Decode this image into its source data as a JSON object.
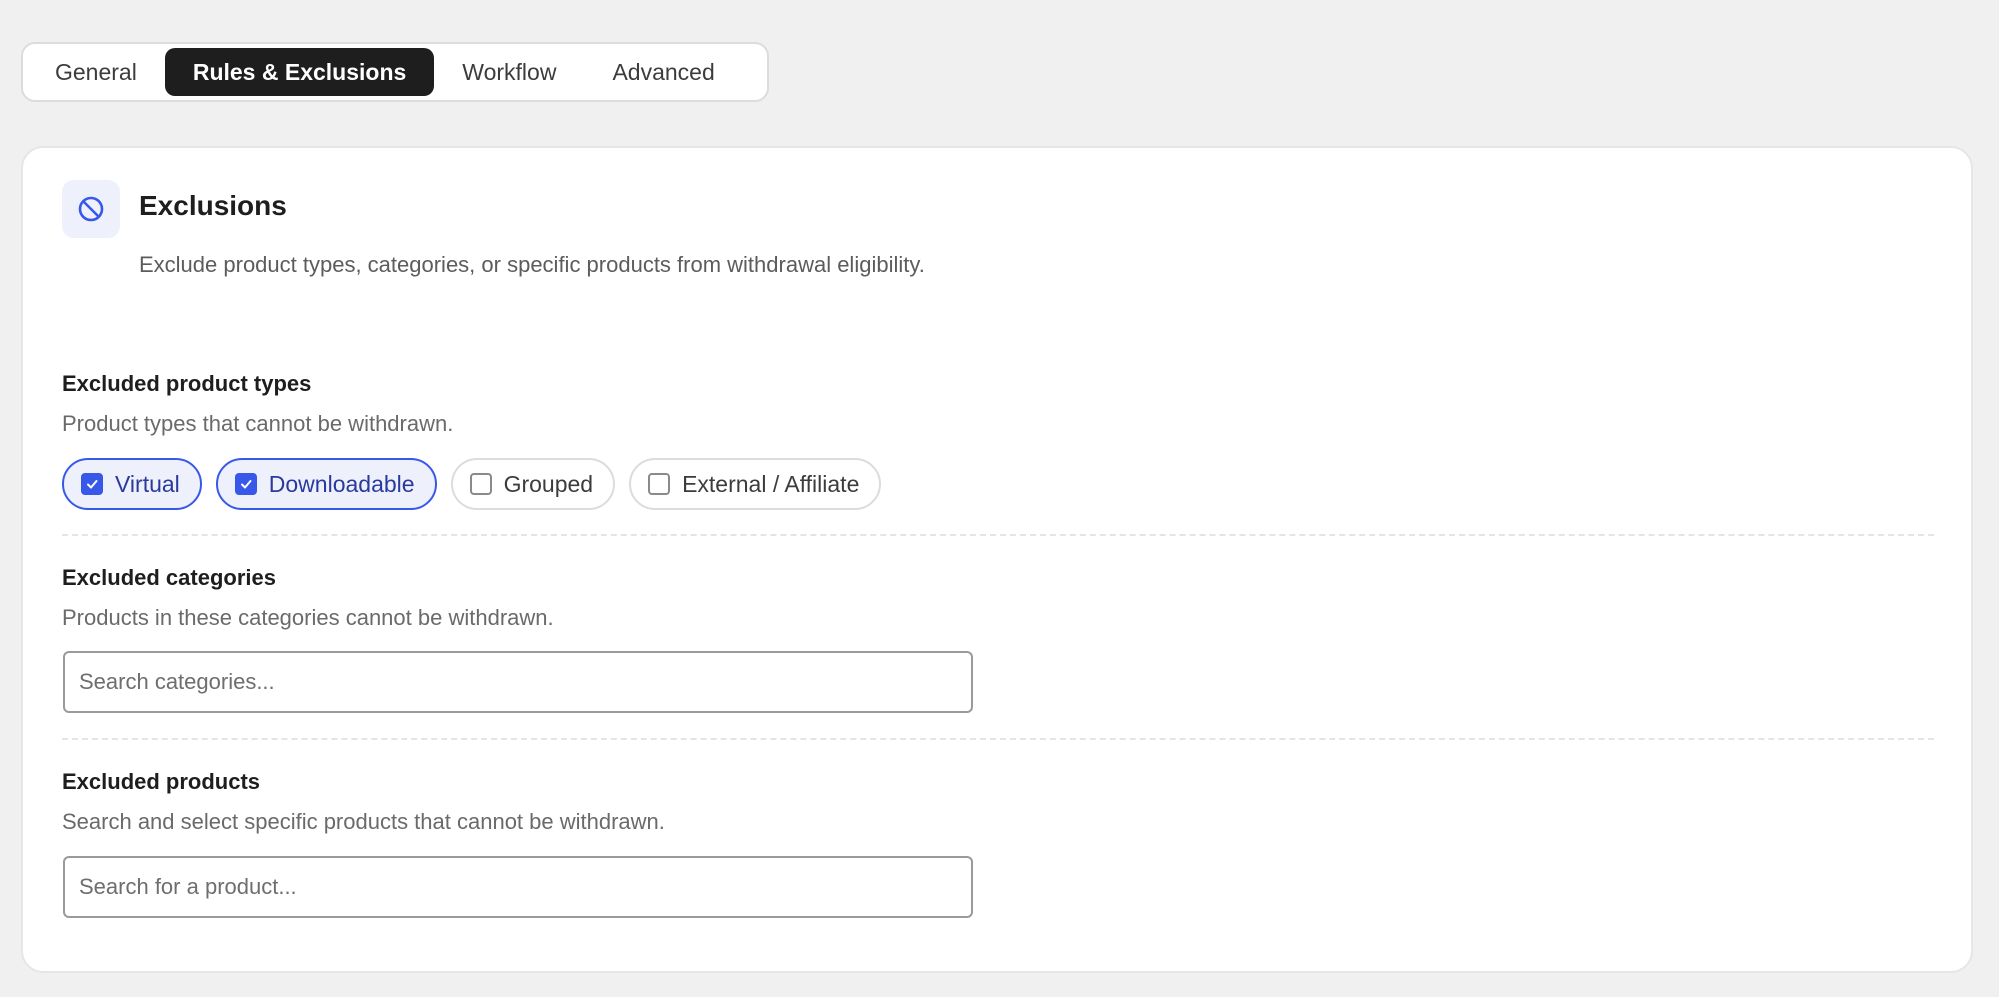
{
  "tabs": [
    {
      "label": "General",
      "active": false
    },
    {
      "label": "Rules & Exclusions",
      "active": true
    },
    {
      "label": "Workflow",
      "active": false
    },
    {
      "label": "Advanced",
      "active": false
    }
  ],
  "section": {
    "icon": "block-icon",
    "title": "Exclusions",
    "description": "Exclude product types, categories, or specific products from withdrawal eligibility."
  },
  "product_types": {
    "title": "Excluded product types",
    "help": "Product types that cannot be withdrawn.",
    "options": [
      {
        "label": "Virtual",
        "checked": true
      },
      {
        "label": "Downloadable",
        "checked": true
      },
      {
        "label": "Grouped",
        "checked": false
      },
      {
        "label": "External / Affiliate",
        "checked": false
      }
    ]
  },
  "categories": {
    "title": "Excluded categories",
    "help": "Products in these categories cannot be withdrawn.",
    "placeholder": "Search categories..."
  },
  "products": {
    "title": "Excluded products",
    "help": "Search and select specific products that cannot be withdrawn.",
    "placeholder": "Search for a product..."
  },
  "colors": {
    "accent": "#3858e9",
    "accent_bg": "#eef0fc",
    "active_tab_bg": "#1e1e1e",
    "page_bg": "#f0f0f0"
  }
}
